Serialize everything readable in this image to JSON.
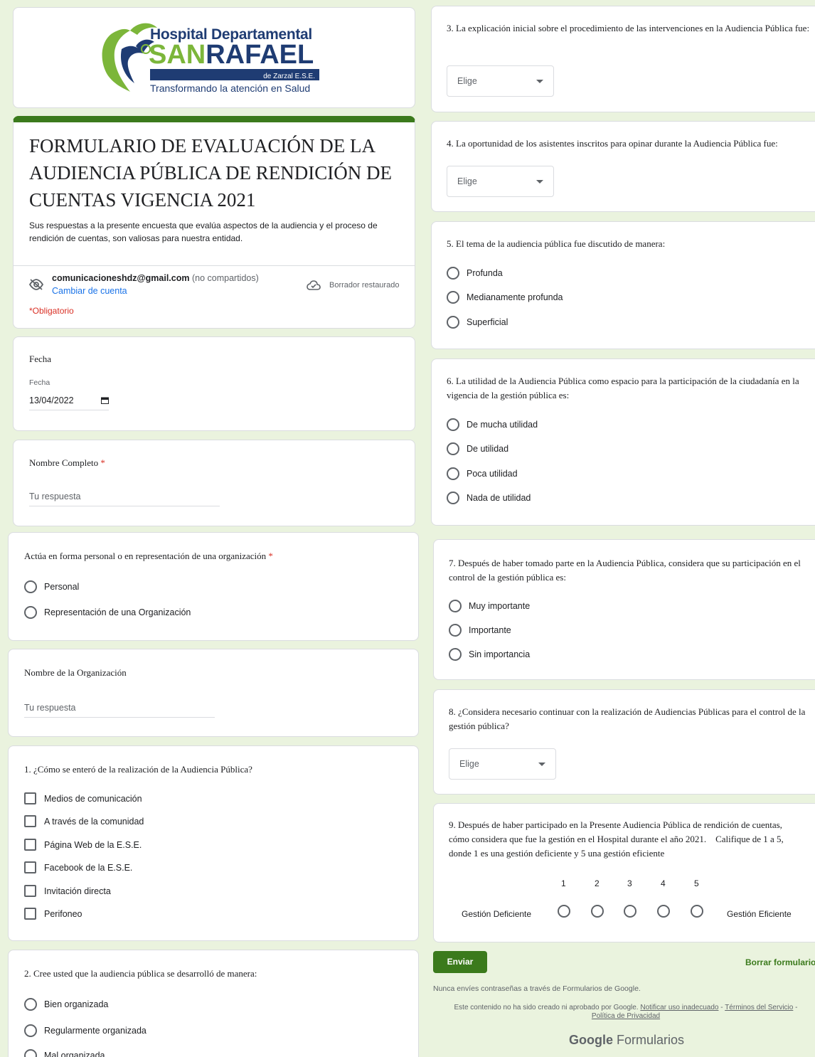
{
  "colors": {
    "accent": "#3b7a1c",
    "background": "#eaf3de",
    "required": "#d93025",
    "link": "#1a73e8"
  },
  "header": {
    "logo_line1": "Hospital Departamental",
    "logo_line2a": "SAN",
    "logo_line2b": "RAFAEL",
    "logo_line3": "de Zarzal E.S.E.",
    "logo_tagline": "Transformando la atención en Salud"
  },
  "form": {
    "title": "FORMULARIO DE EVALUACIÓN DE LA AUDIENCIA PÚBLICA DE RENDICIÓN DE CUENTAS VIGENCIA 2021",
    "description": "Sus respuestas a la presente encuesta que evalúa aspectos de la audiencia y el proceso de rendición de cuentas, son valiosas para nuestra entidad.",
    "account_email": "comunicacioneshdz@gmail.com",
    "account_note": "(no compartidos)",
    "switch_account": "Cambiar de cuenta",
    "draft_status": "Borrador restaurado",
    "required_note": "*Obligatorio"
  },
  "fecha": {
    "title": "Fecha",
    "label": "Fecha",
    "value": "13/04/2022"
  },
  "nombre": {
    "title": "Nombre Completo",
    "star": "*",
    "placeholder": "Tu respuesta"
  },
  "actua": {
    "title": "Actúa en forma personal o en representación de una organización",
    "star": "*",
    "options": [
      "Personal",
      "Representación de una Organización"
    ]
  },
  "organizacion": {
    "title": "Nombre de la Organización",
    "placeholder": "Tu respuesta"
  },
  "q1": {
    "title": "1. ¿Cómo se enteró de la realización de la Audiencia Pública?",
    "options": [
      "Medios de comunicación",
      "A través de la comunidad",
      "Página Web de la E.S.E.",
      "Facebook de la E.S.E.",
      "Invitación directa",
      "Perifoneo"
    ]
  },
  "q2": {
    "title": "2. Cree usted que la audiencia pública se desarrolló de manera:",
    "options": [
      "Bien organizada",
      "Regularmente organizada",
      "Mal organizada"
    ]
  },
  "q3": {
    "title": "3. La explicación inicial sobre el procedimiento de las intervenciones en la Audiencia Pública fue:",
    "select": "Elige"
  },
  "q4": {
    "title": "4. La oportunidad de los asistentes inscritos para opinar durante la Audiencia Pública fue:",
    "select": "Elige"
  },
  "q5": {
    "title": "5. El tema de la audiencia pública fue discutido de manera:",
    "options": [
      "Profunda",
      "Medianamente profunda",
      "Superficial"
    ]
  },
  "q6": {
    "title": "6. La utilidad de la Audiencia Pública como espacio para la participación de la ciudadanía en la vigencia de la gestión pública es:",
    "options": [
      "De mucha utilidad",
      "De utilidad",
      "Poca utilidad",
      "Nada de utilidad"
    ]
  },
  "q7": {
    "title": "7. Después de haber tomado parte en la Audiencia Pública, considera que su participación en el control de la gestión pública es:",
    "options": [
      "Muy importante",
      "Importante",
      "Sin importancia"
    ]
  },
  "q8": {
    "title": "8. ¿Considera necesario continuar con la realización de Audiencias Públicas para el control de la gestión pública?",
    "select": "Elige"
  },
  "q9": {
    "title": "9. Después de haber participado en la Presente Audiencia Pública de rendición de cuentas, cómo considera que fue la gestión en el Hospital durante el año 2021.    Califique de 1 a 5, donde 1 es una gestión deficiente y 5 una gestión eficiente",
    "scale": [
      "1",
      "2",
      "3",
      "4",
      "5"
    ],
    "low_label": "Gestión Deficiente",
    "high_label": "Gestión Eficiente"
  },
  "footer": {
    "submit": "Enviar",
    "clear": "Borrar formulario",
    "warning": "Nunca envíes contraseñas a través de Formularios de Google.",
    "disclaimer": "Este contenido no ha sido creado ni aprobado por Google.",
    "report_link": "Notificar uso inadecuado",
    "sep1": "-",
    "terms_link": "Términos del Servicio",
    "sep2": "-",
    "privacy_link": "Política de Privacidad",
    "brand_google": "Google",
    "brand_forms": "Formularios"
  }
}
